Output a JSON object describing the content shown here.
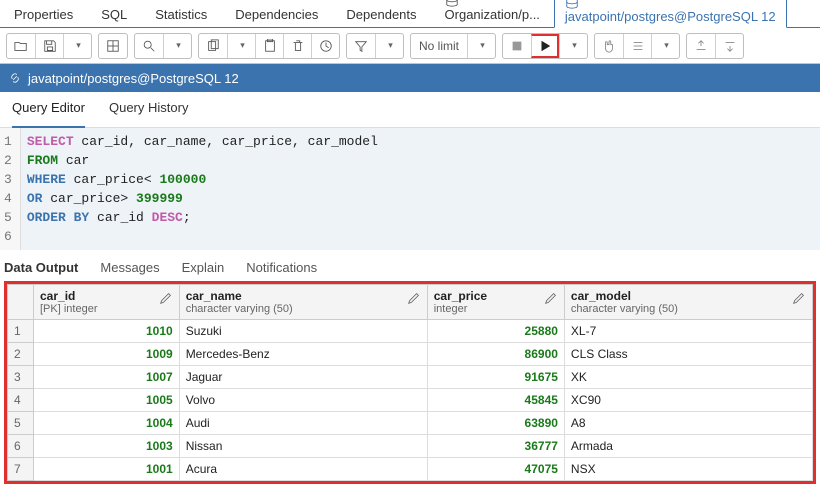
{
  "topTabs": {
    "properties": "Properties",
    "sql": "SQL",
    "statistics": "Statistics",
    "dependencies": "Dependencies",
    "dependents": "Dependents",
    "org": "Organization/p...",
    "conn": "javatpoint/postgres@PostgreSQL 12"
  },
  "toolbar": {
    "noLimit": "No limit"
  },
  "connBar": "javatpoint/postgres@PostgreSQL 12",
  "editorTabs": {
    "queryEditor": "Query Editor",
    "queryHistory": "Query History"
  },
  "code": {
    "lines": [
      "1",
      "2",
      "3",
      "4",
      "5",
      "6"
    ],
    "l1_kw": "SELECT",
    "l1_rest": " car_id, car_name, car_price, car_model",
    "l2_kw": "FROM",
    "l2_rest": " car",
    "l3_kw": "WHERE",
    "l3_mid": " car_price< ",
    "l3_num": "100000",
    "l4_kw": "OR",
    "l4_mid": " car_price> ",
    "l4_num": "399999",
    "l5_kw": "ORDER BY",
    "l5_mid": " car_id ",
    "l5_desc": "DESC",
    "l5_end": ";"
  },
  "outTabs": {
    "data": "Data Output",
    "messages": "Messages",
    "explain": "Explain",
    "notifications": "Notifications"
  },
  "grid": {
    "cols": {
      "car_id": {
        "name": "car_id",
        "type": "[PK] integer"
      },
      "car_name": {
        "name": "car_name",
        "type": "character varying (50)"
      },
      "car_price": {
        "name": "car_price",
        "type": "integer"
      },
      "car_model": {
        "name": "car_model",
        "type": "character varying (50)"
      }
    },
    "rows": [
      {
        "n": "1",
        "car_id": "1010",
        "car_name": "Suzuki",
        "car_price": "25880",
        "car_model": "XL-7"
      },
      {
        "n": "2",
        "car_id": "1009",
        "car_name": "Mercedes-Benz",
        "car_price": "86900",
        "car_model": "CLS Class"
      },
      {
        "n": "3",
        "car_id": "1007",
        "car_name": "Jaguar",
        "car_price": "91675",
        "car_model": "XK"
      },
      {
        "n": "4",
        "car_id": "1005",
        "car_name": "Volvo",
        "car_price": "45845",
        "car_model": "XC90"
      },
      {
        "n": "5",
        "car_id": "1004",
        "car_name": "Audi",
        "car_price": "63890",
        "car_model": "A8"
      },
      {
        "n": "6",
        "car_id": "1003",
        "car_name": "Nissan",
        "car_price": "36777",
        "car_model": "Armada"
      },
      {
        "n": "7",
        "car_id": "1001",
        "car_name": "Acura",
        "car_price": "47075",
        "car_model": "NSX"
      }
    ]
  }
}
